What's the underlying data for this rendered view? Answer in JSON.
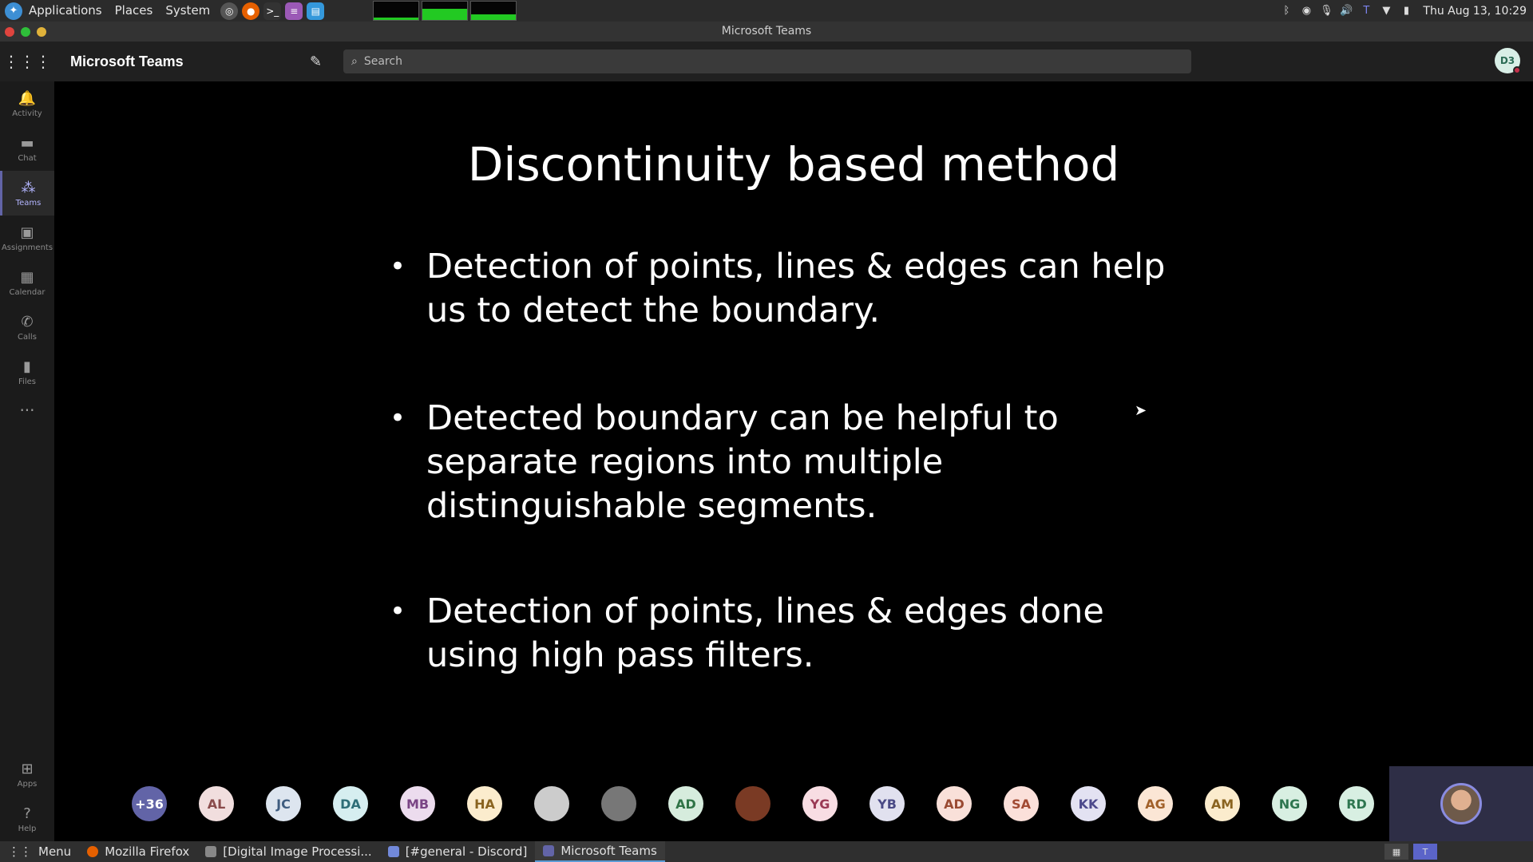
{
  "top_panel": {
    "menu": [
      "Applications",
      "Places",
      "System"
    ],
    "clock": "Thu Aug 13, 10:29"
  },
  "window": {
    "title": "Microsoft Teams"
  },
  "teams": {
    "app_title": "Microsoft Teams",
    "search_placeholder": "Search",
    "user_initials": "D3"
  },
  "rail": {
    "items": [
      {
        "label": "Activity",
        "icon": "bell-icon"
      },
      {
        "label": "Chat",
        "icon": "chat-icon"
      },
      {
        "label": "Teams",
        "icon": "teams-icon"
      },
      {
        "label": "Assignments",
        "icon": "assignments-icon"
      },
      {
        "label": "Calendar",
        "icon": "calendar-icon"
      },
      {
        "label": "Calls",
        "icon": "phone-icon"
      },
      {
        "label": "Files",
        "icon": "files-icon"
      }
    ],
    "bottom": [
      {
        "label": "Apps",
        "icon": "apps-icon"
      },
      {
        "label": "Help",
        "icon": "help-icon"
      }
    ]
  },
  "slide": {
    "title": "Discontinuity based method",
    "bullets": [
      "Detection of points, lines & edges can help us to detect the boundary.",
      "Detected boundary  can be helpful to separate regions into multiple distinguishable segments.",
      "Detection of points, lines & edges done using high pass filters."
    ]
  },
  "participants": [
    {
      "initials": "+36",
      "bg": "#6264a7",
      "fg": "#ffffff"
    },
    {
      "initials": "AL",
      "bg": "#f1dede",
      "fg": "#8a4b4b"
    },
    {
      "initials": "JC",
      "bg": "#dde5ef",
      "fg": "#3f5d80"
    },
    {
      "initials": "DA",
      "bg": "#d6eef0",
      "fg": "#2f6e78"
    },
    {
      "initials": "MB",
      "bg": "#ecdcee",
      "fg": "#7a4585"
    },
    {
      "initials": "HA",
      "bg": "#fbeccd",
      "fg": "#8a6420"
    },
    {
      "initials": "",
      "bg": "#cccccc",
      "fg": "#000000"
    },
    {
      "initials": "",
      "bg": "#777777",
      "fg": "#000000"
    },
    {
      "initials": "AD",
      "bg": "#d6ecdd",
      "fg": "#2f7446"
    },
    {
      "initials": "",
      "bg": "#7a3a24",
      "fg": "#000000"
    },
    {
      "initials": "YG",
      "bg": "#f8dde3",
      "fg": "#9a3a55"
    },
    {
      "initials": "YB",
      "bg": "#e1e1ef",
      "fg": "#4a4a86"
    },
    {
      "initials": "AD",
      "bg": "#f9e0d9",
      "fg": "#9a4a32"
    },
    {
      "initials": "SA",
      "bg": "#fbe0da",
      "fg": "#a24b34"
    },
    {
      "initials": "KK",
      "bg": "#e3e2f2",
      "fg": "#4d4a8c"
    },
    {
      "initials": "AG",
      "bg": "#fbe6d5",
      "fg": "#a2612a"
    },
    {
      "initials": "AM",
      "bg": "#fbeccd",
      "fg": "#8a6420"
    },
    {
      "initials": "NG",
      "bg": "#d8efe2",
      "fg": "#2e7650"
    },
    {
      "initials": "RD",
      "bg": "#d8efe2",
      "fg": "#2e7650"
    }
  ],
  "taskbar": {
    "menu_label": "Menu",
    "tasks": [
      {
        "label": "Mozilla Firefox",
        "color": "#e66000"
      },
      {
        "label": "[Digital Image Processi...",
        "color": "#888888"
      },
      {
        "label": "[#general - Discord]",
        "color": "#7289da"
      },
      {
        "label": "Microsoft Teams",
        "color": "#6264a7"
      }
    ]
  }
}
